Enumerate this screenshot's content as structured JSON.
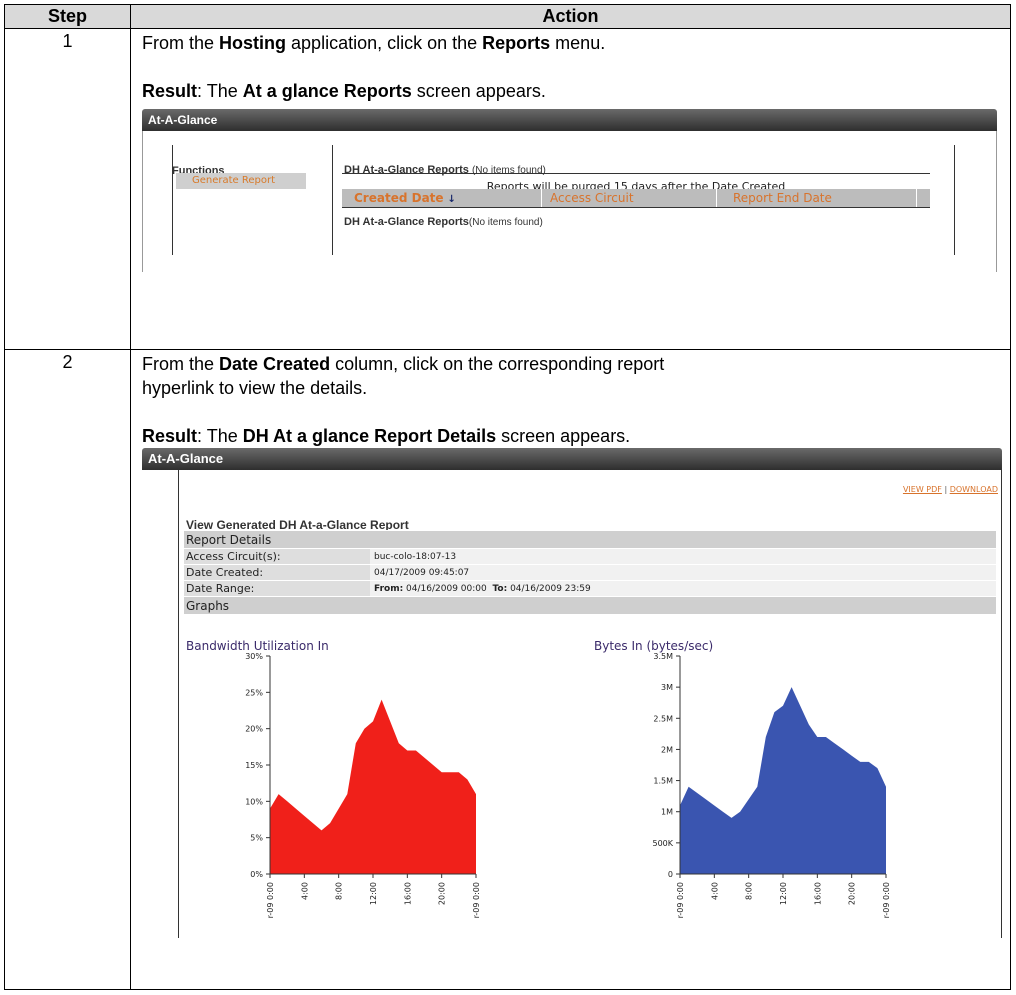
{
  "table": {
    "header_step": "Step",
    "header_action": "Action",
    "steps": [
      {
        "number": "1",
        "line1": {
          "pre": "From the ",
          "b1": "Hosting",
          "mid": " application, click on the ",
          "b2": "Reports",
          "post": " menu."
        },
        "result": {
          "label": "Result",
          "pre": ": The ",
          "b": "At a glance Reports",
          "post": " screen appears."
        }
      },
      {
        "number": "2",
        "line1": {
          "pre": "From the ",
          "b1": "Date Created",
          "mid": " column, click on the corresponding report",
          "post": "hyperlink to view the details."
        },
        "result": {
          "label": "Result",
          "pre": ": The ",
          "b": "DH At a glance Report Details",
          "post": " screen appears."
        }
      }
    ]
  },
  "shot1": {
    "window_title": "At-A-Glance",
    "functions_label": "Functions",
    "generate_report": "Generate Report",
    "list_title": "DH At-a-Glance Reports",
    "no_items": "(No items found)",
    "purge_note": "Reports will be purged 15 days after the Date Created",
    "columns": [
      "Created Date",
      "Access Circuit",
      "Report End Date"
    ],
    "sort_arrow": "↓",
    "list_title2": "DH At-a-Glance Reports",
    "no_items2": "(No items found)"
  },
  "shot2": {
    "window_title": "At-A-Glance",
    "view_pdf": "VIEW PDF",
    "link_sep": "|",
    "download": "DOWNLOAD",
    "title": "View Generated DH At-a-Glance Report",
    "details_band": "Report Details",
    "rows": [
      {
        "key": "Access Circuit(s):",
        "value": "buc-colo-18:07-13"
      },
      {
        "key": "Date Created:",
        "value": "04/17/2009 09:45:07"
      }
    ],
    "range_key": "Date Range:",
    "range_from_label": "From:",
    "range_from": "04/16/2009 00:00",
    "range_to_label": "To:",
    "range_to": "04/16/2009 23:59",
    "graphs_band": "Graphs"
  },
  "chart_data": [
    {
      "type": "area",
      "title": "Bandwidth Utilization In",
      "color": "#f0201a",
      "ylim": [
        0,
        30
      ],
      "y_ticks": [
        "0%",
        "5%",
        "10%",
        "15%",
        "20%",
        "25%",
        "30%"
      ],
      "x_ticks": [
        "r-09 0:00",
        "4:00",
        "8:00",
        "12:00",
        "16:00",
        "20:00",
        "r-09 0:00"
      ],
      "x_hours": [
        0,
        1,
        2,
        3,
        4,
        5,
        6,
        7,
        8,
        9,
        10,
        11,
        12,
        13,
        14,
        15,
        16,
        17,
        18,
        19,
        20,
        21,
        22,
        23,
        24
      ],
      "values": [
        9,
        11,
        10,
        9,
        8,
        7,
        6,
        7,
        9,
        11,
        18,
        20,
        21,
        24,
        21,
        18,
        17,
        17,
        16,
        15,
        14,
        14,
        14,
        13,
        11
      ]
    },
    {
      "type": "area",
      "title": "Bytes In (bytes/sec)",
      "color": "#3a55b0",
      "ylim": [
        0,
        3.5
      ],
      "y_ticks": [
        "0",
        "500K",
        "1M",
        "1.5M",
        "2M",
        "2.5M",
        "3M",
        "3.5M"
      ],
      "x_ticks": [
        "r-09 0:00",
        "4:00",
        "8:00",
        "12:00",
        "16:00",
        "20:00",
        "r-09 0:00"
      ],
      "x_hours": [
        0,
        1,
        2,
        3,
        4,
        5,
        6,
        7,
        8,
        9,
        10,
        11,
        12,
        13,
        14,
        15,
        16,
        17,
        18,
        19,
        20,
        21,
        22,
        23,
        24
      ],
      "values": [
        1.1,
        1.4,
        1.3,
        1.2,
        1.1,
        1.0,
        0.9,
        1.0,
        1.2,
        1.4,
        2.2,
        2.6,
        2.7,
        3.0,
        2.7,
        2.4,
        2.2,
        2.2,
        2.1,
        2.0,
        1.9,
        1.8,
        1.8,
        1.7,
        1.4
      ]
    }
  ]
}
